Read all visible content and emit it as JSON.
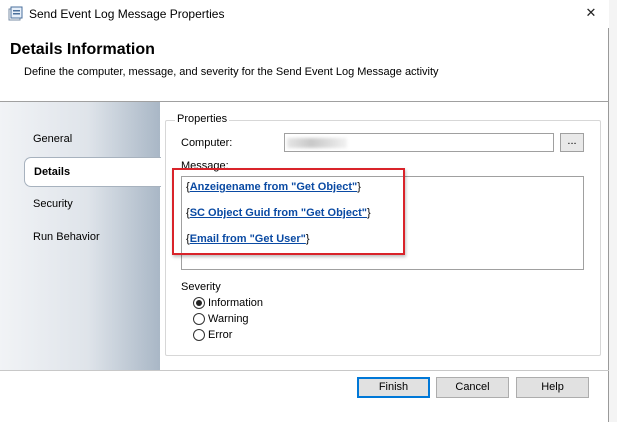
{
  "window": {
    "title": "Send Event Log Message Properties",
    "close_glyph": "✕"
  },
  "header": {
    "title": "Details Information",
    "description": "Define the computer, message, and severity for the Send Event Log Message activity"
  },
  "nav": {
    "items": [
      {
        "label": "General",
        "selected": false
      },
      {
        "label": "Details",
        "selected": true
      },
      {
        "label": "Security",
        "selected": false
      },
      {
        "label": "Run Behavior",
        "selected": false
      }
    ]
  },
  "properties": {
    "group_label": "Properties",
    "computer_label": "Computer:",
    "browse_label": "...",
    "message_label": "Message:",
    "message_lines": [
      {
        "open": "{",
        "link": "Anzeigename from \"Get Object\"",
        "close": "}"
      },
      {
        "open": "{",
        "link": "SC Object Guid from \"Get Object\"",
        "close": "}"
      },
      {
        "open": "{",
        "link": "Email from \"Get User\"",
        "close": "}"
      }
    ],
    "severity_label": "Severity",
    "severity_options": [
      {
        "label": "Information",
        "checked": true
      },
      {
        "label": "Warning",
        "checked": false
      },
      {
        "label": "Error",
        "checked": false
      }
    ]
  },
  "buttons": {
    "finish": "Finish",
    "cancel": "Cancel",
    "help": "Help"
  },
  "colors": {
    "highlight": "#d9232a",
    "link": "#0a4aa3",
    "default_button_border": "#0078d7"
  },
  "icons": [
    "app-icon",
    "close-icon"
  ]
}
